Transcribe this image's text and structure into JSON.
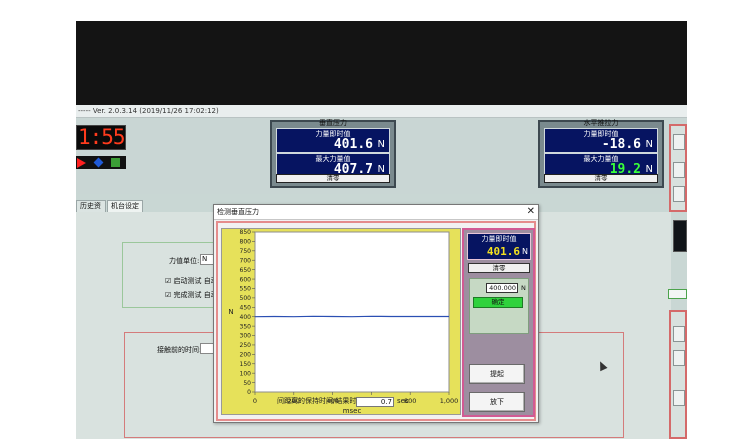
{
  "window": {
    "title": "----- Ver. 2.0.3.14 (2019/11/26 17:02:12)"
  },
  "clock": {
    "time": "1:55"
  },
  "toolbar": {
    "play_icon": "play-icon",
    "diamond_icon": "diamond-icon",
    "stop_icon": "stop-icon"
  },
  "vertical_gauge": {
    "title": "垂直压力",
    "instant_label": "力量即时值",
    "instant_value": "401.6",
    "max_label": "最大力量值",
    "max_value": "407.7",
    "unit": "N",
    "clear_label": "清零"
  },
  "horizontal_gauge": {
    "title": "水平推拉力",
    "instant_label": "力量即时值",
    "instant_value": "-18.6",
    "max_label": "最大力量值",
    "max_value": "19.2",
    "unit": "N",
    "clear_label": "清零",
    "value_color": "#ffffff",
    "max_color": "#39ff39"
  },
  "tabs": [
    {
      "label": "历史资料",
      "active": false
    },
    {
      "label": "机台设定",
      "active": true
    }
  ],
  "settings": {
    "force_unit_label": "力值单位:",
    "force_unit_value": "N",
    "auto_test_label": "☑ 启动测试 自动",
    "finish_test_label": "☑ 完成测试 自动",
    "contact_time_label": "接触前的时间:",
    "bottom_label": "间距离的保持时间/结果时间:",
    "bottom_value": "0.7",
    "bottom_unit": "sec"
  },
  "dialog": {
    "title": "检测垂直压力",
    "close_label": "✕",
    "meter_label": "力量即时值",
    "meter_value": "401.6",
    "meter_unit": "N",
    "clear_label": "清零",
    "set_value": "400.000",
    "set_unit": "N",
    "confirm_label": "确定",
    "raise_label": "提起",
    "lower_label": "放下"
  },
  "chart_data": {
    "type": "line",
    "xlabel": "msec",
    "ylabel": "N",
    "xlim": [
      0,
      1000
    ],
    "ylim": [
      0,
      850
    ],
    "x_ticks": [
      "0",
      "200",
      "400",
      "600",
      "800",
      "1,000"
    ],
    "y_ticks": [
      "0",
      "50",
      "100",
      "150",
      "200",
      "250",
      "300",
      "350",
      "400",
      "450",
      "500",
      "550",
      "600",
      "650",
      "700",
      "750",
      "800",
      "850"
    ],
    "grid": false,
    "line_color": "#2b4fb3",
    "series": [
      {
        "x": [
          0,
          100,
          200,
          300,
          400,
          500,
          600,
          700,
          800,
          1000
        ],
        "y": [
          400,
          401,
          400,
          402,
          401,
          400,
          402,
          401,
          401,
          401
        ]
      }
    ]
  },
  "colors": {
    "clock_digits": "#ff3b1d",
    "meter_bg": "#061461",
    "dialog_meter_value": "#f3e020",
    "confirm_button": "#2fd23c"
  }
}
